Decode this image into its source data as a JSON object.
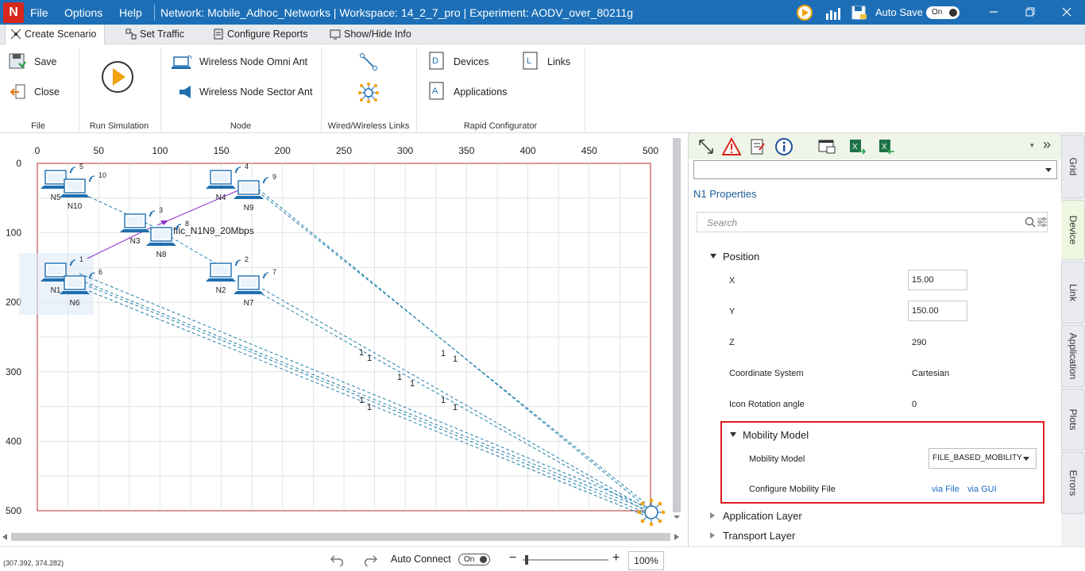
{
  "titlebar": {
    "logo": "N",
    "menu": [
      "File",
      "Options",
      "Help"
    ],
    "title": "Network: Mobile_Adhoc_Networks | Workspace: 14_2_7_pro | Experiment: AODV_over_80211g",
    "auto_save_label": "Auto Save",
    "auto_save_state": "On",
    "icons": [
      "run-icon",
      "plots-icon",
      "save-db-icon"
    ],
    "window_controls": [
      "minimize-icon",
      "restore-icon",
      "close-icon"
    ]
  },
  "tabs": [
    "Create Scenario",
    "Set Traffic",
    "Configure Reports",
    "Show/Hide Info"
  ],
  "ribbon": {
    "file": {
      "save": "Save",
      "close": "Close",
      "label": "File"
    },
    "run": {
      "label": "Run Simulation"
    },
    "node": {
      "omni": "Wireless Node Omni Ant",
      "sector": "Wireless Node Sector Ant",
      "label": "Node"
    },
    "links": {
      "label": "Wired/Wireless Links"
    },
    "rapid": {
      "devices": "Devices",
      "links": "Links",
      "applications": "Applications",
      "label": "Rapid Configurator"
    }
  },
  "canvas": {
    "x_ticks": [
      "0",
      "50",
      "100",
      "150",
      "200",
      "250",
      "300",
      "350",
      "400",
      "450",
      "500"
    ],
    "y_ticks": [
      "0",
      "100",
      "200",
      "300",
      "400",
      "500"
    ],
    "nodes": [
      {
        "name": "N1",
        "badge": "1"
      },
      {
        "name": "N2",
        "badge": "2"
      },
      {
        "name": "N3",
        "badge": "3"
      },
      {
        "name": "N4",
        "badge": "4"
      },
      {
        "name": "N5",
        "badge": "5"
      },
      {
        "name": "N6",
        "badge": "6"
      },
      {
        "name": "N7",
        "badge": "7"
      },
      {
        "name": "N8",
        "badge": "8"
      },
      {
        "name": "N9",
        "badge": "9"
      },
      {
        "name": "N10",
        "badge": "10"
      }
    ],
    "traffic_label": "ffic_N1N9_20Mbps",
    "link_marks": [
      "1",
      "1",
      "1",
      "1",
      "1",
      "1",
      "1",
      "1",
      "1",
      "1",
      "1",
      "1"
    ]
  },
  "statusbar": {
    "coords": "(307.392, 374.282)",
    "auto_connect_label": "Auto Connect",
    "auto_connect_state": "On",
    "zoom": "100%",
    "zoom_minus": "−",
    "zoom_plus": "+"
  },
  "panel": {
    "toolbar_icons": [
      "resize-icon",
      "warning-icon",
      "notes-icon",
      "info-icon",
      "window-icon",
      "excel-export-icon",
      "excel-import-icon"
    ],
    "overflow": "»",
    "title": "N1 Properties",
    "search_placeholder": "Search",
    "position_header": "Position",
    "props": [
      {
        "label": "X",
        "value": "15.00"
      },
      {
        "label": "Y",
        "value": "150.00"
      },
      {
        "label": "Z",
        "value": "290"
      },
      {
        "label": "Coordinate System",
        "value": "Cartesian"
      },
      {
        "label": "Icon Rotation angle",
        "value": "0"
      }
    ],
    "mobility_header": "Mobility Model",
    "mobility_model_label": "Mobility Model",
    "mobility_model_value": "FILE_BASED_MOBILITY",
    "config_file_label": "Configure Mobility File",
    "via_file": "via File",
    "via_gui": "via GUI",
    "application_layer": "Application Layer",
    "transport_layer": "Transport Layer"
  },
  "side_tabs": [
    "Grid",
    "Device",
    "Link",
    "Application",
    "Plots",
    "Errors"
  ],
  "colors": {
    "accent": "#1c6fb7",
    "highlight": "#e0181e",
    "link": "#1a6fc4",
    "wire": "#1f7fa8",
    "traffic": "#8b2fc9"
  }
}
